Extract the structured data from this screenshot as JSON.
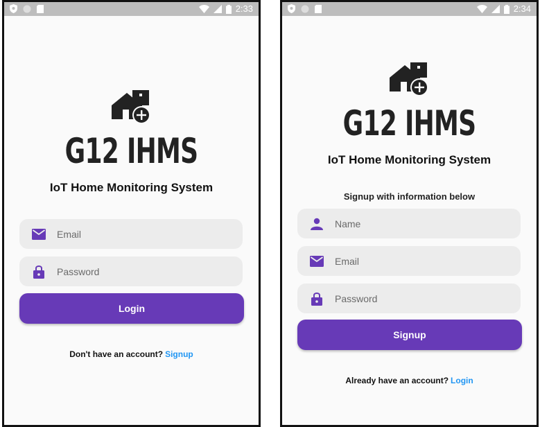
{
  "colors": {
    "accent": "#673ab7",
    "link": "#2196f3",
    "field_bg": "#ececec",
    "statusbar": "#bdbdbd"
  },
  "login": {
    "status_time": "2:33",
    "app_title": "G12 IHMS",
    "subtitle": "IoT Home Monitoring System",
    "email_placeholder": "Email",
    "password_placeholder": "Password",
    "login_label": "Login",
    "footer_text": "Don't have an account?",
    "footer_link": "Signup"
  },
  "signup": {
    "status_time": "2:34",
    "app_title": "G12 IHMS",
    "subtitle": "IoT Home Monitoring System",
    "prompt": "Signup with information below",
    "name_placeholder": "Name",
    "email_placeholder": "Email",
    "password_placeholder": "Password",
    "signup_label": "Signup",
    "footer_text": "Already have an account?",
    "footer_link": "Login"
  },
  "icons": [
    "shield-icon",
    "circle-icon",
    "sdcard-icon",
    "wifi-icon",
    "signal-icon",
    "battery-icon",
    "home-add-icon",
    "mail-icon",
    "lock-icon",
    "person-icon"
  ]
}
